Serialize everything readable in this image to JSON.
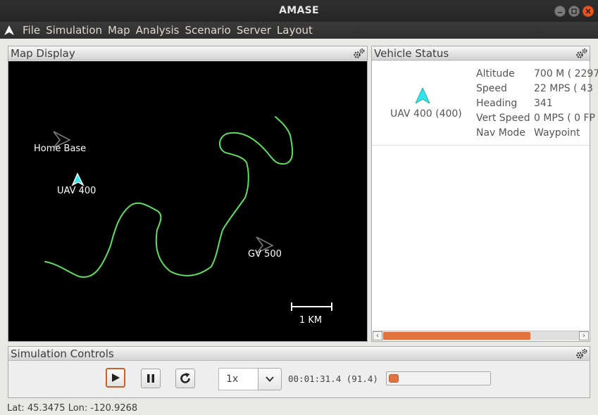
{
  "window": {
    "title": "AMASE"
  },
  "menu": {
    "items": [
      "File",
      "Simulation",
      "Map",
      "Analysis",
      "Scenario",
      "Server",
      "Layout"
    ]
  },
  "map_panel": {
    "title": "Map Display",
    "labels": {
      "home_base": "Home Base",
      "uav": "UAV 400",
      "gv": "GV 500"
    },
    "scale_label": "1 KM",
    "colors": {
      "background": "#000000",
      "path": "#5ee05e",
      "uav_icon": "#2ee8ee"
    }
  },
  "vehicle_status": {
    "title": "Vehicle Status",
    "vehicle_name": "UAV 400 (400)",
    "fields": [
      {
        "label": "Altitude",
        "value": "700 M ( 2297"
      },
      {
        "label": "Speed",
        "value": "22 MPS ( 43"
      },
      {
        "label": "Heading",
        "value": "341"
      },
      {
        "label": "Vert Speed",
        "value": "0 MPS ( 0 FP"
      },
      {
        "label": "Nav Mode",
        "value": "Waypoint"
      }
    ],
    "scroll_position": 0.0
  },
  "sim_controls": {
    "title": "Simulation Controls",
    "speed": "1x",
    "time": "00:01:31.4 (91.4)",
    "progress": 0.06,
    "accent_color": "#e2733f"
  },
  "status": {
    "coords": "Lat: 45.3475 Lon: -120.9268"
  }
}
